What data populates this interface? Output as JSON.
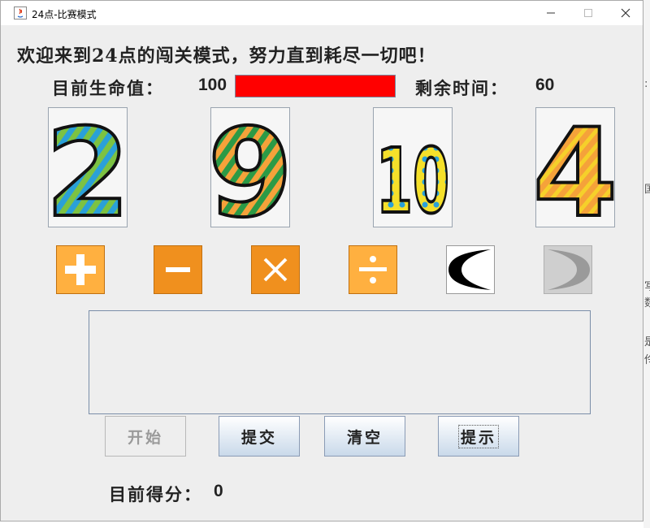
{
  "window": {
    "title": "24点-比赛模式",
    "controls": {
      "minimize_icon": "minimize-icon",
      "maximize_icon": "maximize-icon",
      "close_icon": "close-icon"
    }
  },
  "welcome_text": "欢迎来到24点的闯关模式，努力直到耗尽一切吧！",
  "life": {
    "label": "目前生命值：",
    "value": "100",
    "fill_fraction": 1.0,
    "bar_color": "#ff0000"
  },
  "time": {
    "label": "剩余时间：",
    "value": "60"
  },
  "cards": [
    {
      "value": "2",
      "icon": "card-2-icon"
    },
    {
      "value": "9",
      "icon": "card-9-icon"
    },
    {
      "value": "10",
      "icon": "card-10-icon"
    },
    {
      "value": "4",
      "icon": "card-4-icon"
    }
  ],
  "operators": [
    {
      "symbol": "+",
      "icon": "plus-icon",
      "color": "#ffb040"
    },
    {
      "symbol": "−",
      "icon": "minus-icon",
      "color": "#f0901e"
    },
    {
      "symbol": "×",
      "icon": "multiply-icon",
      "color": "#f0901e"
    },
    {
      "symbol": "÷",
      "icon": "divide-icon",
      "color": "#ffb040"
    },
    {
      "symbol": "(",
      "icon": "left-paren-icon",
      "enabled": true
    },
    {
      "symbol": ")",
      "icon": "right-paren-icon",
      "enabled": false
    }
  ],
  "expression": {
    "value": ""
  },
  "buttons": {
    "start": "开始",
    "submit": "提交",
    "clear": "清空",
    "hint": "提示"
  },
  "score": {
    "label": "目前得分：",
    "value": "0"
  }
}
